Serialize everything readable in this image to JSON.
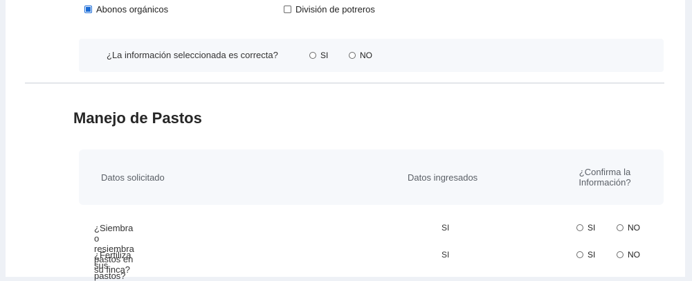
{
  "practices": [
    {
      "label": "Abonos orgánicos",
      "checked": true
    },
    {
      "label": "División de potreros",
      "checked": false
    }
  ],
  "confirm_section": {
    "question": "¿La información seleccionada es correcta?",
    "yes_label": "SI",
    "no_label": "NO"
  },
  "pastos_section": {
    "title": "Manejo de Pastos",
    "headers": {
      "requested": "Datos solicitado",
      "entered": "Datos ingresados",
      "confirm_line1": "¿Confirma la",
      "confirm_line2": "Información?"
    },
    "rows": [
      {
        "question": "¿Siembra o resiembra pastos en su finca?",
        "value": "SI",
        "yes_label": "SI",
        "no_label": "NO"
      },
      {
        "question": "¿Fertiliza sus pastos?",
        "value": "SI",
        "yes_label": "SI",
        "no_label": "NO"
      }
    ]
  },
  "colors": {
    "accent": "#1a6bd6",
    "panel_bg": "#ffffff",
    "page_bg": "#eef1f6",
    "soft_bg": "#f6f8fb"
  }
}
